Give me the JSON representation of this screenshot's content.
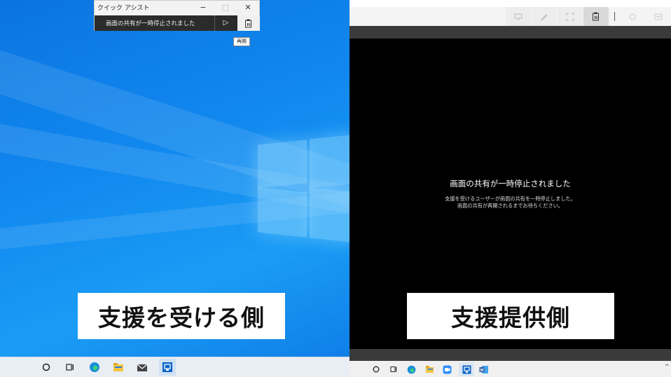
{
  "quick_assist": {
    "title": "クイック アシスト",
    "minimize": "−",
    "maximize": "□",
    "close": "✕",
    "status": "画面の共有が一時停止されました",
    "play": "▷",
    "tooltip": "再開"
  },
  "left_caption": "支援を受ける側",
  "right_caption": "支援提供側",
  "viewer": {
    "paused_title": "画面の共有が一時停止されました",
    "paused_msg_line1": "支援を受けるユーザーが画面の共有を一時停止しました。",
    "paused_msg_line2": "画面の共有が再開されるまでお待ちください。"
  },
  "taskbar_left": {
    "icons": [
      "search-icon",
      "task-view-icon",
      "edge-icon",
      "file-explorer-icon",
      "mail-icon",
      "quick-assist-icon"
    ]
  },
  "taskbar_right": {
    "icons": [
      "search-icon",
      "task-view-icon",
      "edge-icon",
      "file-explorer-icon",
      "zoom-icon",
      "quick-assist-icon",
      "word-icon"
    ],
    "chevron": "^"
  },
  "colors": {
    "desktop_blue": "#1188ef",
    "viewer_black": "#000000",
    "edge_blue": "#1a8fd8",
    "folder_yellow": "#f5c542",
    "word_blue": "#2b579a"
  }
}
